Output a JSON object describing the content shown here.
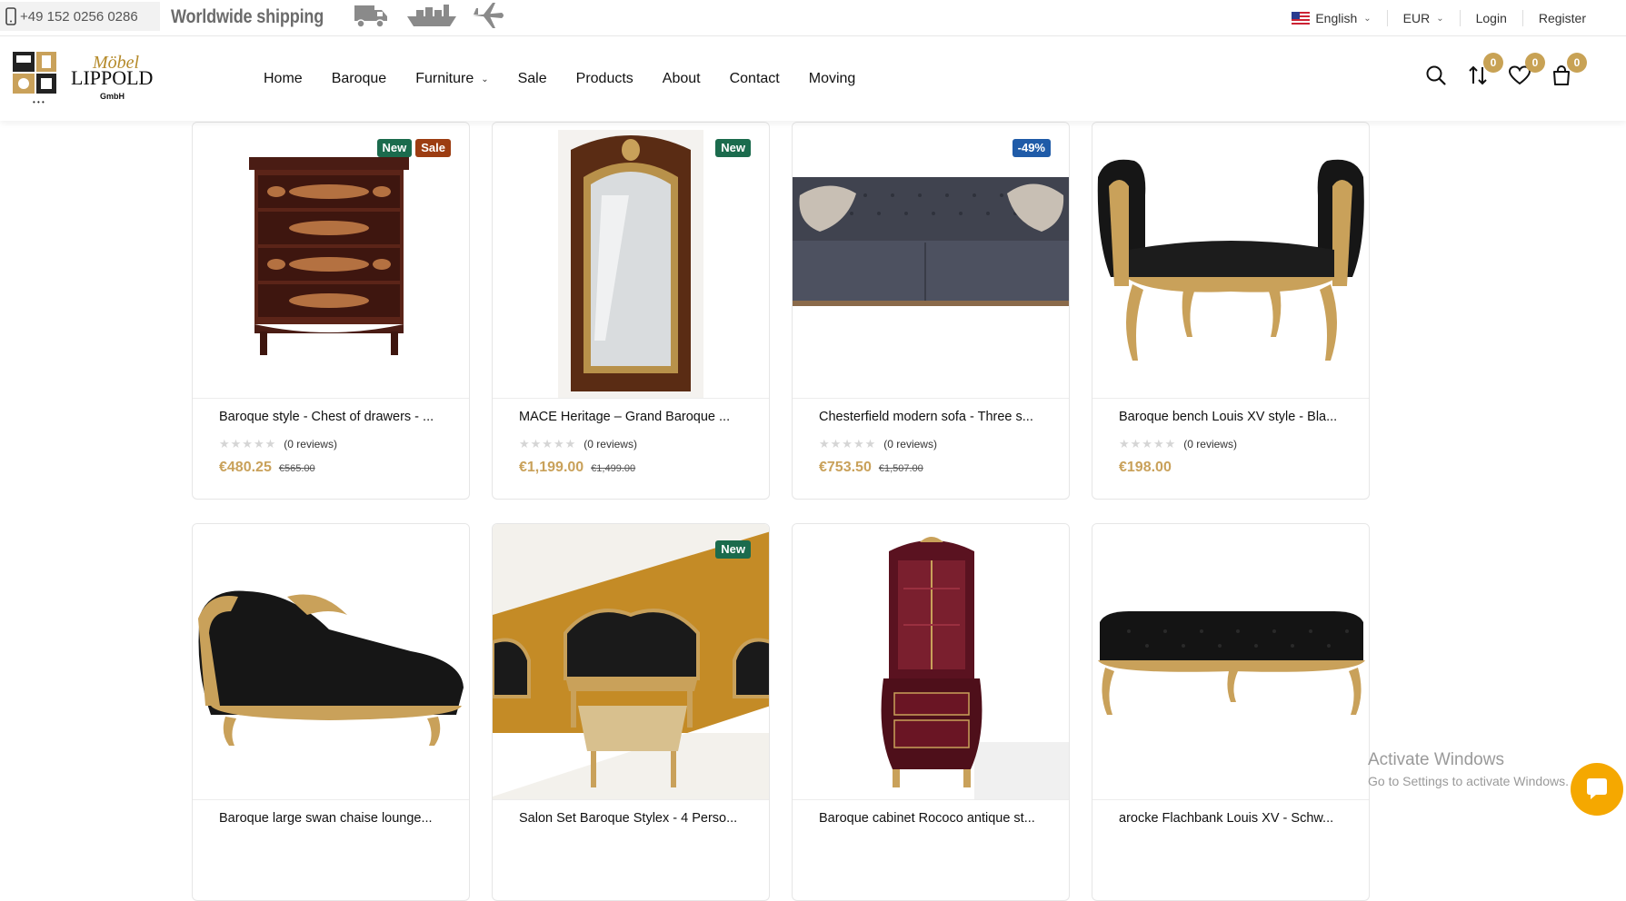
{
  "topbar": {
    "phone": "+49 152 0256 0286",
    "shipping": "Worldwide shipping",
    "shipping_icons": [
      "truck-icon",
      "ship-icon",
      "plane-icon"
    ],
    "language": "English",
    "currency": "EUR",
    "login": "Login",
    "register": "Register"
  },
  "header": {
    "logo_alt": "Möbel Lippold GmbH",
    "logo_text_1": "LIPPOLD",
    "logo_text_2": "GmbH",
    "nav": [
      "Home",
      "Baroque",
      "Furniture",
      "Sale",
      "Products",
      "About",
      "Contact",
      "Moving"
    ],
    "icons": {
      "compare_count": "0",
      "wishlist_count": "0",
      "cart_count": "0"
    }
  },
  "products": [
    {
      "title": "Baroque style - Chest of drawers - ...",
      "badges": [
        "New",
        "Sale"
      ],
      "reviews": "(0 reviews)",
      "price": "€480.25",
      "old_price": "€565.00",
      "rating": 0
    },
    {
      "title": "MACE Heritage – Grand Baroque ...",
      "badges": [
        "New"
      ],
      "reviews": "(0 reviews)",
      "price": "€1,199.00",
      "old_price": "€1,499.00",
      "rating": 0
    },
    {
      "title": "Chesterfield modern sofa - Three s...",
      "badges": [
        "-49%"
      ],
      "reviews": "(0 reviews)",
      "price": "€753.50",
      "old_price": "€1,507.00",
      "rating": 0
    },
    {
      "title": "Baroque bench Louis XV style - Bla...",
      "badges": [],
      "reviews": "(0 reviews)",
      "price": "€198.00",
      "old_price": "",
      "rating": 0
    },
    {
      "title": "Baroque large swan chaise lounge...",
      "badges": [],
      "reviews": "",
      "price": "",
      "old_price": "",
      "rating": 0
    },
    {
      "title": "Salon Set Baroque Stylex - 4 Perso...",
      "badges": [
        "New"
      ],
      "reviews": "",
      "price": "",
      "old_price": "",
      "rating": 0
    },
    {
      "title": "Baroque cabinet Rococo antique st...",
      "badges": [],
      "reviews": "",
      "price": "",
      "old_price": "",
      "rating": 0
    },
    {
      "title": "arocke Flachbank Louis XV - Schw...",
      "badges": [],
      "reviews": "",
      "price": "",
      "old_price": "",
      "rating": 0
    }
  ],
  "overlay": {
    "activate_title": "Activate Windows",
    "activate_sub": "Go to Settings to activate Windows."
  },
  "colors": {
    "accent_gold": "#c9a15a",
    "badge_new": "#1b6b4d",
    "badge_sale": "#9c3d12",
    "badge_discount": "#1f5ba8",
    "chat_button": "#f5a800"
  }
}
